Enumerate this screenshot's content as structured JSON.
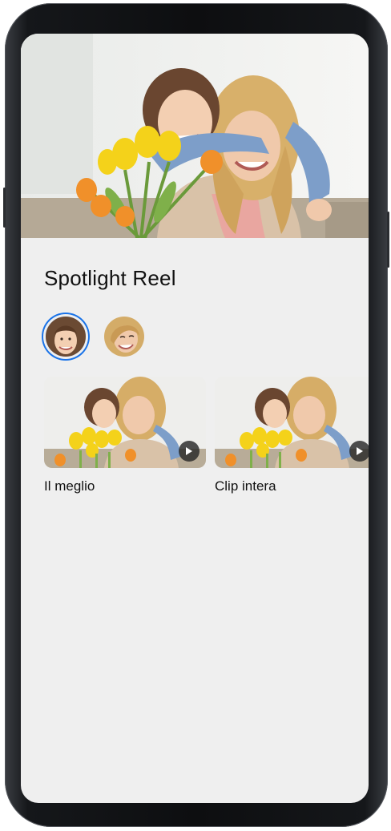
{
  "header": {
    "title": "Spotlight Reel"
  },
  "people": [
    {
      "name": "girl",
      "selected": true,
      "icon": "face-avatar-girl"
    },
    {
      "name": "woman",
      "selected": false,
      "icon": "face-avatar-woman"
    }
  ],
  "videos": [
    {
      "label": "Il meglio",
      "icon": "play-icon"
    },
    {
      "label": "Clip intera",
      "icon": "play-icon"
    }
  ],
  "colors": {
    "accent": "#1a73e8",
    "background": "#efefef",
    "text": "#111111"
  }
}
